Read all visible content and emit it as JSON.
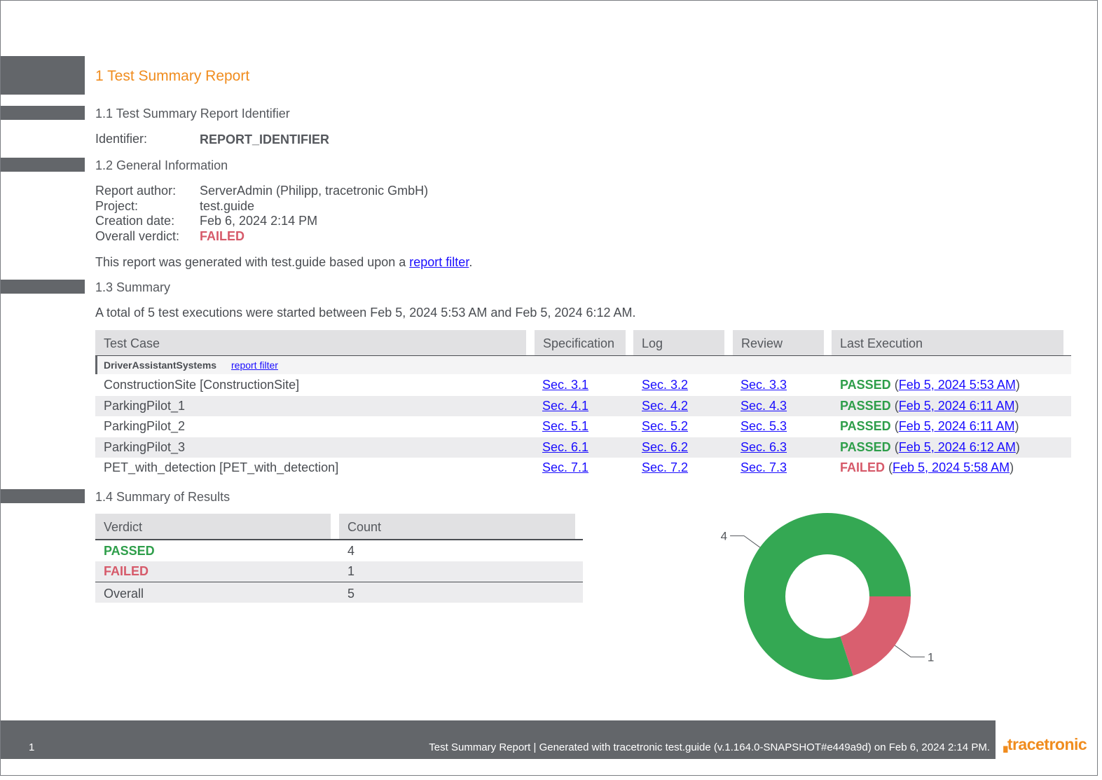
{
  "section1": {
    "title": "1 Test Summary Report"
  },
  "section11": {
    "title": "1.1 Test Summary Report Identifier",
    "identifier_label": "Identifier:",
    "identifier_value": "REPORT_IDENTIFIER"
  },
  "section12": {
    "title": "1.2 General Information",
    "author_label": "Report author:",
    "author_value": "ServerAdmin (Philipp, tracetronic GmbH)",
    "project_label": "Project:",
    "project_value": "test.guide",
    "date_label": "Creation date:",
    "date_value": "Feb 6, 2024 2:14  PM",
    "verdict_label": "Overall verdict:",
    "verdict_value": "FAILED",
    "note_prefix": "This report was generated with test.guide based upon a ",
    "note_link": "report filter",
    "note_suffix": "."
  },
  "section13": {
    "title": "1.3 Summary",
    "intro": "A total of 5 test executions were started between Feb 5, 2024 5:53  AM and Feb 5, 2024 6:12  AM.",
    "headers": [
      "Test Case",
      "Specification",
      "Log",
      "Review",
      "Last Execution"
    ],
    "group": {
      "name": "DriverAssistantSystems",
      "link": "report filter"
    },
    "rows": [
      {
        "name": "ConstructionSite [ConstructionSite]",
        "spec": "Sec. 3.1",
        "log": "Sec. 3.2",
        "review": "Sec. 3.3",
        "verdict": "PASSED",
        "date": "Feb 5, 2024 5:53  AM"
      },
      {
        "name": "ParkingPilot_1",
        "spec": "Sec. 4.1",
        "log": "Sec. 4.2",
        "review": "Sec. 4.3",
        "verdict": "PASSED",
        "date": "Feb 5, 2024 6:11  AM"
      },
      {
        "name": "ParkingPilot_2",
        "spec": "Sec. 5.1",
        "log": "Sec. 5.2",
        "review": "Sec. 5.3",
        "verdict": "PASSED",
        "date": "Feb 5, 2024 6:11  AM"
      },
      {
        "name": "ParkingPilot_3",
        "spec": "Sec. 6.1",
        "log": "Sec. 6.2",
        "review": "Sec. 6.3",
        "verdict": "PASSED",
        "date": "Feb 5, 2024 6:12  AM"
      },
      {
        "name": "PET_with_detection [PET_with_detection]",
        "spec": "Sec. 7.1",
        "log": "Sec. 7.2",
        "review": "Sec. 7.3",
        "verdict": "FAILED",
        "date": "Feb 5, 2024 5:58  AM"
      }
    ],
    "paren_open": "(",
    "paren_close": ")"
  },
  "section14": {
    "title": "1.4 Summary of Results",
    "headers": [
      "Verdict",
      "Count"
    ],
    "rows": [
      {
        "verdict": "PASSED",
        "count": "4"
      },
      {
        "verdict": "FAILED",
        "count": "1"
      }
    ],
    "overall_label": "Overall",
    "overall_count": "5"
  },
  "chart_data": {
    "type": "pie",
    "categories": [
      "PASSED",
      "FAILED"
    ],
    "values": [
      4,
      1
    ],
    "colors": [
      "#34a853",
      "#d95f6f"
    ],
    "data_labels": [
      "4",
      "1"
    ],
    "donut": true
  },
  "footer": {
    "page_number": "1",
    "text": "Test Summary Report | Generated with tracetronic test.guide (v.1.164.0-SNAPSHOT#e449a9d) on Feb 6, 2024 2:14  PM.",
    "logo": "tracetronic"
  },
  "colors": {
    "accent": "#f08c1e",
    "bar": "#63666a",
    "passed": "#2e9e4a",
    "failed": "#d65a6a",
    "link": "#1a0dff"
  }
}
